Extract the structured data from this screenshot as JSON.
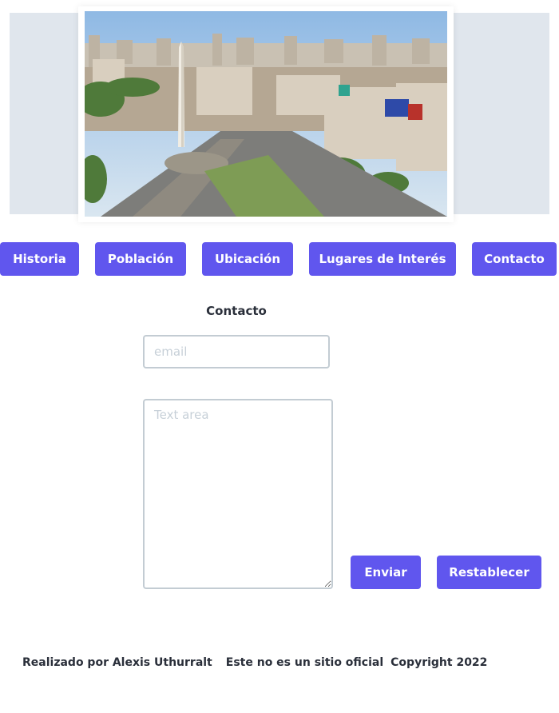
{
  "hero": {
    "image_alt": "Obelisco de Buenos Aires, vista aérea de la ciudad"
  },
  "nav": {
    "items": [
      {
        "label": "Historia"
      },
      {
        "label": "Población"
      },
      {
        "label": "Ubicación"
      },
      {
        "label": "Lugares de Interés"
      },
      {
        "label": "Contacto"
      }
    ]
  },
  "contact_form": {
    "title": "Contacto",
    "email_placeholder": "email",
    "email_value": "",
    "textarea_placeholder": "Text area",
    "textarea_value": "",
    "submit_label": "Enviar",
    "reset_label": "Restablecer"
  },
  "footer": {
    "author": "Realizado por Alexis Uthurralt",
    "disclaimer": "Este no es un sitio oficial",
    "copyright": "Copyright 2022"
  },
  "colors": {
    "accent": "#6056ee",
    "hero_bg": "#e0e6ed",
    "text": "#2a2f3a",
    "input_border": "#c3ccd3"
  }
}
